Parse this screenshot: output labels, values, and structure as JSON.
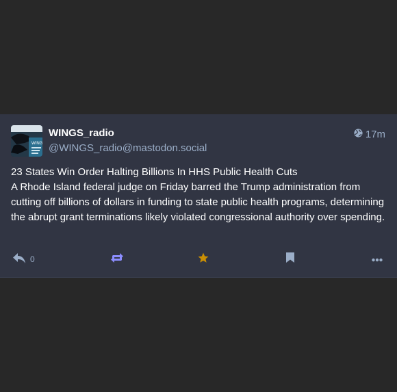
{
  "status": {
    "display_name": "WINGS_radio",
    "account": "@WINGS_radio@mastodon.social",
    "visibility_icon": "globe-icon",
    "time_ago": "17m",
    "content_title": "23 States Win Order Halting Billions In HHS Public Health Cuts",
    "content_body": "A Rhode Island federal judge on Friday barred the Trump administration from cutting off billions of dollars in funding to state public health programs, determining the abrupt grant terminations likely violated congressional authority over spending.",
    "avatar_text": "WINGS"
  },
  "actions": {
    "reply_count": "0",
    "reply_icon": "reply-icon",
    "boost_icon": "boost-icon",
    "favourite_icon": "star-icon",
    "bookmark_icon": "bookmark-icon",
    "more_icon": "ellipsis-icon"
  },
  "colors": {
    "background": "#282828",
    "card": "#313543",
    "text": "#ffffff",
    "muted": "#9baec8",
    "boost_active": "#8c8dff",
    "favourite_active": "#ca8f04"
  }
}
